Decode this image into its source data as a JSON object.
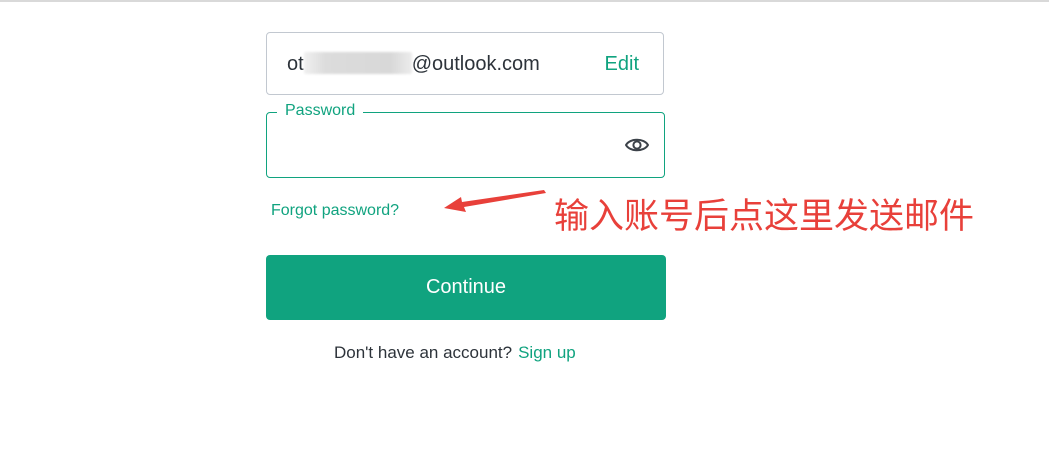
{
  "email": {
    "prefix": "ot",
    "suffix": "@outlook.com",
    "edit_label": "Edit"
  },
  "password": {
    "label": "Password",
    "value": "",
    "toggle_icon": "eye-icon"
  },
  "forgot_link": "Forgot password?",
  "annotation": {
    "text": "输入账号后点这里发送邮件",
    "color": "#e8403a"
  },
  "continue_label": "Continue",
  "signup": {
    "prompt": "Don't have an account?",
    "link_label": "Sign up"
  },
  "colors": {
    "accent": "#10a37f",
    "text": "#2d333a",
    "border": "#c2c8d0"
  }
}
